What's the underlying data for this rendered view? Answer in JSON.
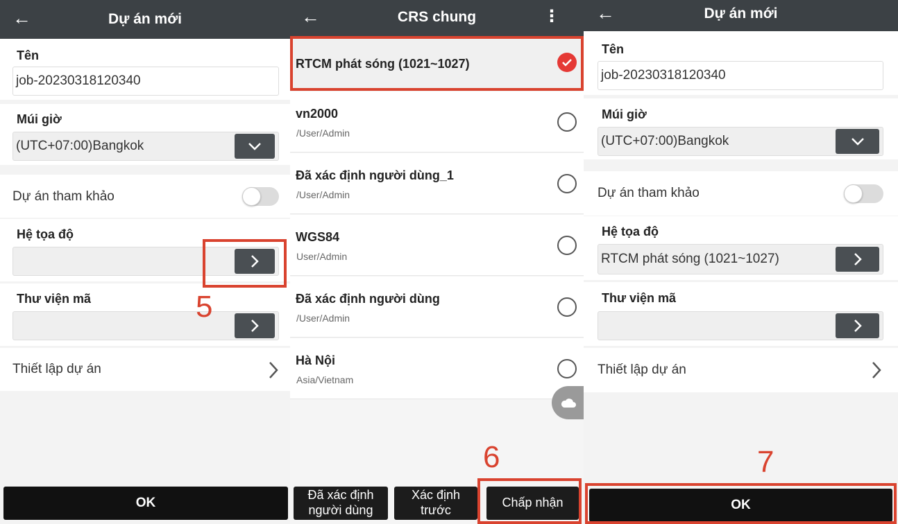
{
  "panel1": {
    "title": "Dự án mới",
    "name_label": "Tên",
    "name_value": "job-20230318120340",
    "timezone_label": "Múi giờ",
    "timezone_value": "(UTC+07:00)Bangkok",
    "reference_label": "Dự án tham khảo",
    "crs_label": "Hệ tọa độ",
    "crs_value": "",
    "codelib_label": "Thư viện mã",
    "codelib_value": "",
    "settings_label": "Thiết lập dự án",
    "ok_label": "OK",
    "step": "5"
  },
  "panel2": {
    "title": "CRS chung",
    "items": [
      {
        "name": "RTCM phát sóng (1021~1027)",
        "path": "",
        "selected": true
      },
      {
        "name": "vn2000",
        "path": "/User/Admin",
        "selected": false
      },
      {
        "name": "Đã xác định người dùng_1",
        "path": "/User/Admin",
        "selected": false
      },
      {
        "name": "WGS84",
        "path": "User/Admin",
        "selected": false
      },
      {
        "name": "Đã xác định người dùng",
        "path": "/User/Admin",
        "selected": false
      },
      {
        "name": "Hà Nội",
        "path": "Asia/Vietnam",
        "selected": false
      }
    ],
    "btn_user_defined_1": "Đã xác định",
    "btn_user_defined_2": "người dùng",
    "btn_predefined_1": "Xác định",
    "btn_predefined_2": "trước",
    "btn_accept": "Chấp nhận",
    "step": "6"
  },
  "panel3": {
    "title": "Dự án mới",
    "name_label": "Tên",
    "name_value": "job-20230318120340",
    "timezone_label": "Múi giờ",
    "timezone_value": "(UTC+07:00)Bangkok",
    "reference_label": "Dự án tham khảo",
    "crs_label": "Hệ tọa độ",
    "crs_value": "RTCM phát sóng (1021~1027)",
    "codelib_label": "Thư viện mã",
    "codelib_value": "",
    "settings_label": "Thiết lập dự án",
    "ok_label": "OK",
    "step": "7"
  },
  "colors": {
    "header": "#3c4145",
    "annotation": "#d9432f",
    "selected_radio": "#e53935",
    "button": "#111111"
  },
  "icons": [
    "back-arrow-icon",
    "chevron-down-icon",
    "chevron-right-icon",
    "more-vertical-icon",
    "check-icon",
    "cloud-icon"
  ]
}
